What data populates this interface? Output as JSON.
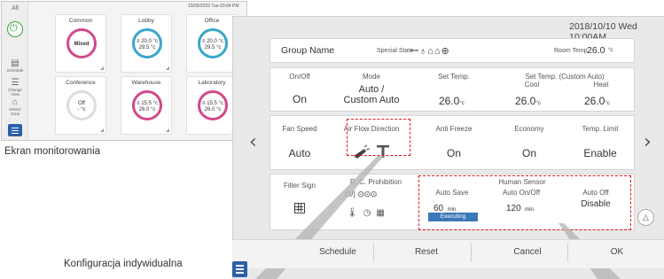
{
  "monitor": {
    "timestamp": "10/05/2023 Tue 03:04 PM",
    "all_label": "All",
    "sidebar": [
      "Schedule",
      "Change View",
      "Detect Zone"
    ],
    "tiles": [
      {
        "name": "Common",
        "l1": "Mixed",
        "l2": "",
        "color": "#d14a8a"
      },
      {
        "name": "Lobby",
        "l1": "≡ 20.0 °c",
        "l2": "29.5 °c",
        "color": "#3aa6c9"
      },
      {
        "name": "Office",
        "l1": "≡ 20.0 °c",
        "l2": "29.5 °c",
        "color": "#3aa6c9"
      },
      {
        "name": "Conference",
        "l1": "Off",
        "l2": "- °c",
        "color": "#cccccc"
      },
      {
        "name": "Warehouse",
        "l1": "≡ 15.5 °c",
        "l2": "26.0 °c",
        "color": "#d14a8a"
      },
      {
        "name": "Laboratory",
        "l1": "≡ 15.5 °c",
        "l2": "26.0 °c",
        "color": "#d14a8a"
      }
    ]
  },
  "captions": {
    "monitoring": "Ekran monitorowania",
    "individual": "Konfiguracja indywidualna"
  },
  "detail": {
    "datetime": "2018/10/10 Wed 10:00AM",
    "group_name": "Group Name",
    "special_state_label": "Special State",
    "special_state_icons": "ꟷ♁⌂⌂⊕",
    "room_temp_label": "Room Temp.",
    "room_temp_value": "26.0",
    "room_temp_unit": "°c",
    "row1": {
      "onoff_label": "On/Off",
      "onoff_value": "On",
      "mode_label": "Mode",
      "mode_value1": "Auto /",
      "mode_value2": "Custom Auto",
      "set_temp_label": "Set Temp.",
      "set_temp_value": "26.0",
      "set_temp_unit": "°c",
      "custom_label": "Set Temp. (Custom Auto)",
      "cool_label": "Cool",
      "cool_value": "26.0",
      "cool_unit": "°c",
      "heat_label": "Heat",
      "heat_value": "26.0",
      "heat_unit": "°c"
    },
    "row2": {
      "fan_label": "Fan Speed",
      "fan_value": "Auto",
      "airflow_label": "Air Flow Direction",
      "antifreeze_label": "Anti Freeze",
      "antifreeze_value": "On",
      "economy_label": "Economy",
      "economy_value": "On",
      "templimit_label": "Temp. Limit",
      "templimit_value": "Enable"
    },
    "row3": {
      "filter_label": "Filter Sign",
      "rc_label": "R. C. Prohibition",
      "rc_icons_top": "⏻/|  ⚙⚙⚙",
      "human_label": "Human Sensor",
      "autosave_label": "Auto Save",
      "autosave_value": "60",
      "autosave_unit": "min.",
      "executing": "Executing",
      "autoonoff_label": "Auto On/Off",
      "autoonoff_value": "120",
      "autoonoff_unit": "min.",
      "autooff_label": "Auto Off",
      "autooff_value": "Disable"
    },
    "buttons": {
      "schedule": "Schedule",
      "reset": "Reset",
      "cancel": "Cancel",
      "ok": "OK"
    },
    "accent": "#2b5fa8",
    "highlight": "#e01919"
  }
}
